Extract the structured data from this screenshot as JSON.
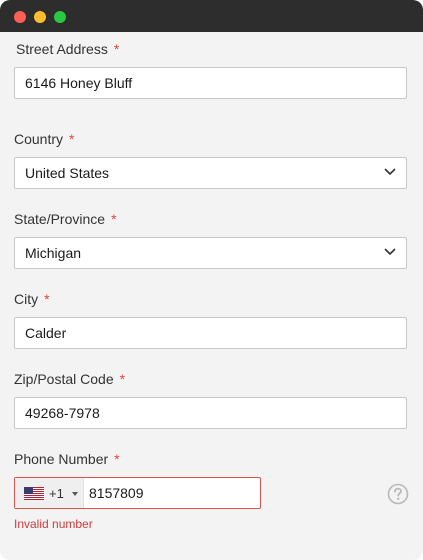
{
  "colors": {
    "required": "#e0443c",
    "error": "#cf3b3b",
    "titlebar": "#2d2d2d"
  },
  "form": {
    "street": {
      "label": "Street Address",
      "required_mark": "*",
      "value": "6146 Honey Bluff"
    },
    "country": {
      "label": "Country",
      "required_mark": "*",
      "value": "United States",
      "icon": "chevron-down-icon"
    },
    "state": {
      "label": "State/Province",
      "required_mark": "*",
      "value": "Michigan",
      "icon": "chevron-down-icon"
    },
    "city": {
      "label": "City",
      "required_mark": "*",
      "value": "Calder"
    },
    "zip": {
      "label": "Zip/Postal Code",
      "required_mark": "*",
      "value": "49268-7978"
    },
    "phone": {
      "label": "Phone Number",
      "required_mark": "*",
      "country_flag": "us-flag-icon",
      "dial_code": "+1",
      "value": "8157809",
      "error": "Invalid number",
      "help_icon": "question-circle-icon"
    }
  }
}
